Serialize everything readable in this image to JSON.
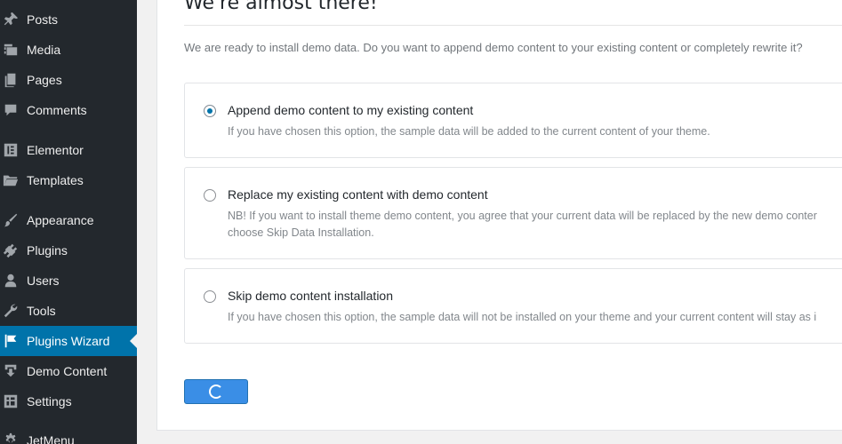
{
  "sidebar": {
    "items": [
      {
        "label": "Posts",
        "icon": "pin-icon"
      },
      {
        "label": "Media",
        "icon": "media-icon"
      },
      {
        "label": "Pages",
        "icon": "pages-icon"
      },
      {
        "label": "Comments",
        "icon": "comment-icon"
      },
      {
        "label": "Elementor",
        "icon": "elementor-icon"
      },
      {
        "label": "Templates",
        "icon": "folder-icon"
      },
      {
        "label": "Appearance",
        "icon": "brush-icon"
      },
      {
        "label": "Plugins",
        "icon": "plug-icon"
      },
      {
        "label": "Users",
        "icon": "user-icon"
      },
      {
        "label": "Tools",
        "icon": "wrench-icon"
      },
      {
        "label": "Plugins Wizard",
        "icon": "flag-icon"
      },
      {
        "label": "Demo Content",
        "icon": "download-icon"
      },
      {
        "label": "Settings",
        "icon": "settings-icon"
      },
      {
        "label": "JetMenu",
        "icon": "gear-icon"
      }
    ],
    "active_index": 10,
    "active_color": "#0073aa"
  },
  "main": {
    "heading": "We're almost there!",
    "intro": "We are ready to install demo data. Do you want to append demo content to your existing content or completely rewrite it?",
    "options": [
      {
        "title": "Append demo content to my existing content",
        "desc": [
          "If you have chosen this option, the sample data will be added to the current content of your theme."
        ],
        "checked": true
      },
      {
        "title": "Replace my existing content with demo content",
        "desc": [
          "NB! If you want to install theme demo content, you agree that your current data will be replaced by the new demo conter",
          "choose Skip Data Installation."
        ],
        "checked": false
      },
      {
        "title": "Skip demo content installation",
        "desc": [
          "If you have chosen this option, the sample data will not be installed on your theme and your current content will stay as i"
        ],
        "checked": false
      }
    ],
    "submit": {
      "state": "loading",
      "icon": "spinner-icon",
      "color": "#3a8ee6"
    }
  }
}
